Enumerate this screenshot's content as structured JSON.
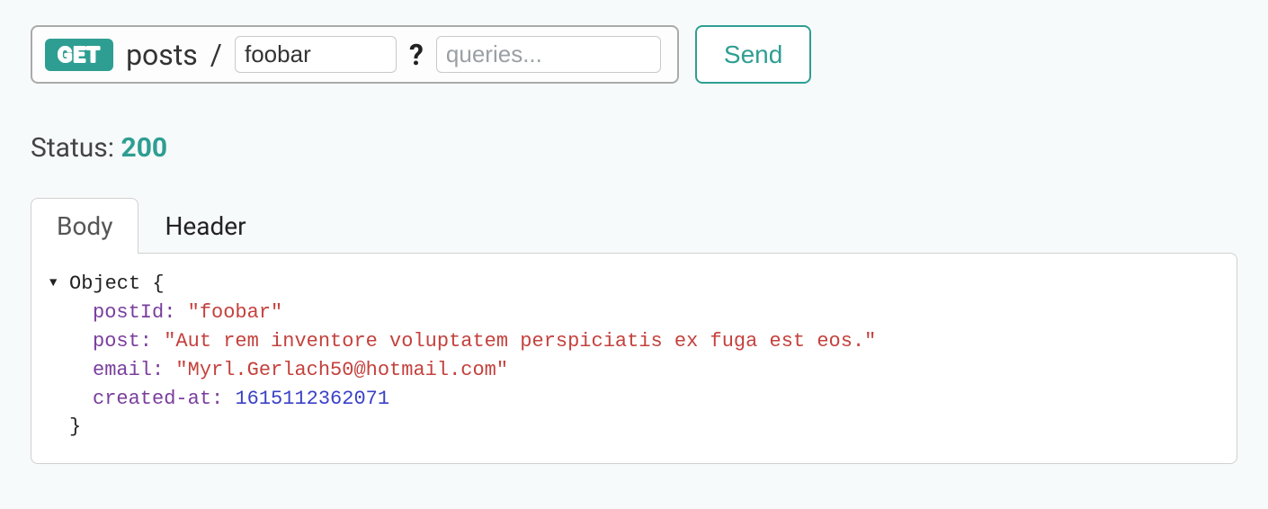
{
  "request": {
    "method": "GET",
    "pathSegment": "posts",
    "slash": "/",
    "pathParamValue": "foobar",
    "qmark": "?",
    "queryPlaceholder": "queries...",
    "queryValue": "",
    "sendLabel": "Send"
  },
  "status": {
    "label": "Status: ",
    "code": "200"
  },
  "tabs": {
    "body": "Body",
    "header": "Header"
  },
  "response": {
    "objectLabel": "Object {",
    "closing": "}",
    "entries": [
      {
        "key": "postId:",
        "value": "\"foobar\"",
        "type": "string"
      },
      {
        "key": "post:",
        "value": "\"Aut rem inventore voluptatem perspiciatis ex fuga est eos.\"",
        "type": "string"
      },
      {
        "key": "email:",
        "value": "\"Myrl.Gerlach50@hotmail.com\"",
        "type": "string"
      },
      {
        "key": "created-at:",
        "value": "1615112362071",
        "type": "number"
      }
    ]
  }
}
